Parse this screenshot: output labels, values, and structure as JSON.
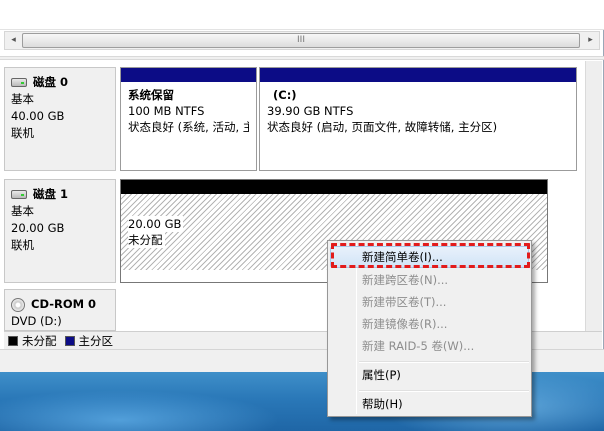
{
  "disks": [
    {
      "name": "磁盘 0",
      "type": "基本",
      "size": "40.00 GB",
      "status": "联机",
      "volumes": [
        {
          "name": "系统保留",
          "detail": "100 MB NTFS",
          "status": "状态良好 (系统, 活动, 主"
        },
        {
          "name": "(C:)",
          "detail": "39.90 GB NTFS",
          "status": "状态良好 (启动, 页面文件, 故障转储, 主分区)"
        }
      ]
    },
    {
      "name": "磁盘 1",
      "type": "基本",
      "size": "20.00 GB",
      "status": "联机",
      "volumes": [
        {
          "detail": "20.00 GB",
          "status": "未分配"
        }
      ]
    },
    {
      "name": "CD-ROM 0",
      "type": "DVD (D:)"
    }
  ],
  "legend": [
    {
      "label": "未分配",
      "color": "#000000"
    },
    {
      "label": "主分区",
      "color": "#0c0c86"
    }
  ],
  "scrollbar": {
    "thumb_grip": "III",
    "left_arrow": "◂",
    "right_arrow": "▸"
  },
  "context_menu": {
    "items": [
      {
        "label": "新建简单卷(I)...",
        "enabled": true,
        "highlighted": true
      },
      {
        "label": "新建跨区卷(N)...",
        "enabled": false
      },
      {
        "label": "新建带区卷(T)...",
        "enabled": false
      },
      {
        "label": "新建镜像卷(R)...",
        "enabled": false
      },
      {
        "label": "新建 RAID-5 卷(W)...",
        "enabled": false
      },
      {
        "label": "属性(P)",
        "enabled": true
      },
      {
        "label": "帮助(H)",
        "enabled": true
      }
    ]
  },
  "colors": {
    "primary_partition": "#0c0c86",
    "unallocated": "#000000",
    "callout": "#e21b1b"
  }
}
